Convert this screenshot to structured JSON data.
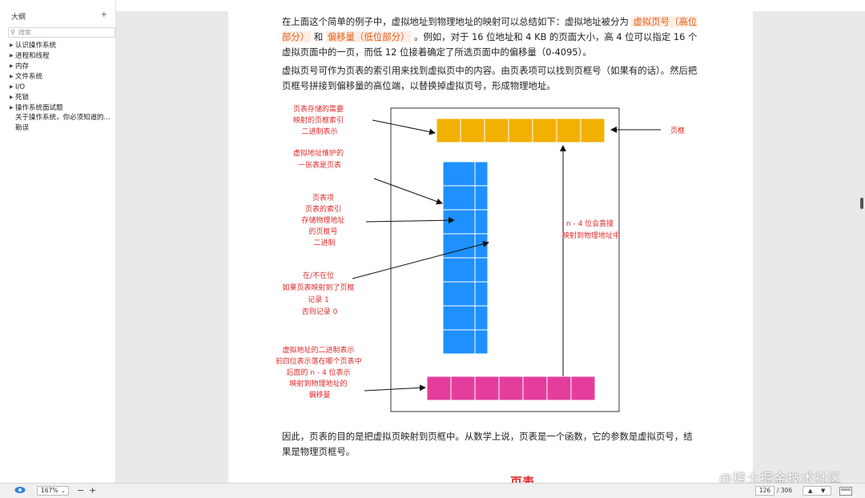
{
  "sidebar": {
    "title": "大纲",
    "add_label": "+",
    "search_placeholder": "搜索",
    "items": [
      {
        "label": "认识操作系统",
        "expandable": true
      },
      {
        "label": "进程和线程",
        "expandable": true
      },
      {
        "label": "内存",
        "expandable": true
      },
      {
        "label": "文件系统",
        "expandable": true
      },
      {
        "label": "I/O",
        "expandable": true
      },
      {
        "label": "死锁",
        "expandable": true
      },
      {
        "label": "操作系统面试题",
        "expandable": true
      },
      {
        "label": "关于操作系统，你必须知道的...",
        "expandable": false
      },
      {
        "label": "勘误",
        "expandable": false
      }
    ]
  },
  "doc": {
    "p1_a": "在上面这个简单的例子中，虚拟地址到物理地址的映射可以总结如下：虚拟地址被分为",
    "p1_hl1": "虚拟页号（高位部分）",
    "p1_b": "和",
    "p1_hl2": "偏移量（低位部分）",
    "p1_c": "。例如，对于 16 位地址和 4 KB 的页面大小，高 4 位可以指定 16 个虚拟页面中的一页，而低 12 位接着确定了所选页面中的偏移量（0-4095）。",
    "p2": "虚拟页号可作为页表的索引用来找到虚拟页中的内容。由页表项可以找到页框号（如果有的话）。然后把页框号拼接到偏移量的高位端，以替换掉虚拟页号，形成物理地址。",
    "p3": "因此，页表的目的是把虚拟页映射到页框中。从数学上说，页表是一个函数，它的参数是虚拟页号，结果是物理页框号。",
    "next_heading": "页表"
  },
  "diagram": {
    "label_frame_index": [
      "页表存储的需要",
      "映射的页框索引",
      "二进制表示"
    ],
    "label_page_table": [
      "虚拟地址维护的",
      "一张表是页表"
    ],
    "label_entry": [
      "页表项",
      "页表的索引",
      "存储物理地址",
      "的页框号",
      "二进制"
    ],
    "label_present": [
      "在/不在位",
      "如果页表映射到了页框",
      "记录 1",
      "否则记录 0"
    ],
    "label_vaddr": [
      "虚拟地址的二进制表示",
      "前四位表示落在哪个页表中",
      "后面的 n - 4 位表示",
      "映射到物理地址的",
      "偏移量"
    ],
    "label_frame": "页框",
    "label_direct": [
      "n - 4 位会直接",
      "映射到物理地址中"
    ],
    "colors": {
      "frame": "#f2b100",
      "table": "#1e90ff",
      "vaddr": "#e43d9d",
      "text": "#e02a2a"
    }
  },
  "toolbar": {
    "eye_icon": "eye-icon",
    "zoom": "167%",
    "zoom_out": "−",
    "zoom_in": "+",
    "page_current": "126",
    "page_total": "/ 306",
    "nav_up": "▲",
    "nav_down": "▼"
  },
  "watermark": "@稀土掘金技术社区"
}
